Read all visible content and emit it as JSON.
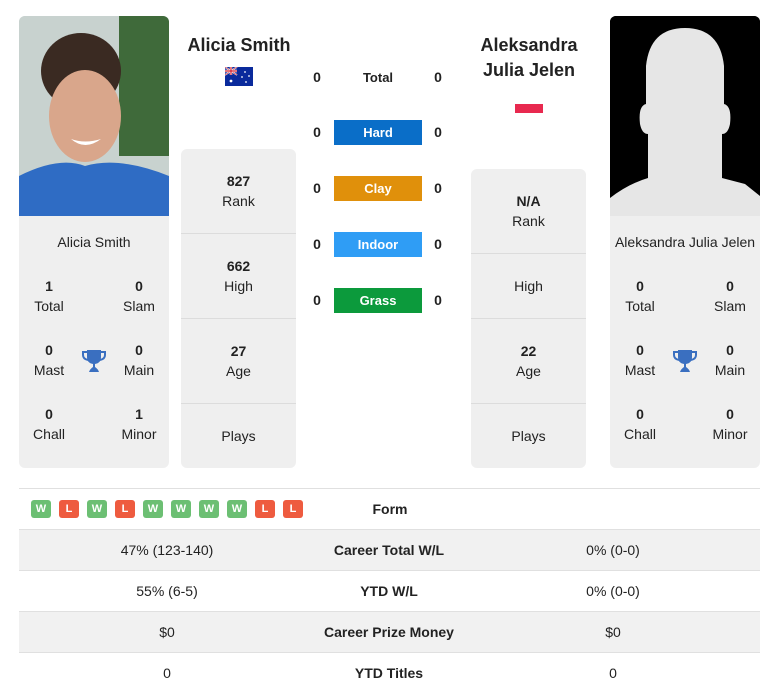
{
  "player1": {
    "name": "Alicia Smith",
    "flag": "australia-flag",
    "card_name": "Alicia Smith",
    "titles": {
      "total": {
        "value": "1",
        "label": "Total"
      },
      "slam": {
        "value": "0",
        "label": "Slam"
      },
      "mast": {
        "value": "0",
        "label": "Mast"
      },
      "main": {
        "value": "0",
        "label": "Main"
      },
      "chall": {
        "value": "0",
        "label": "Chall"
      },
      "minor": {
        "value": "1",
        "label": "Minor"
      }
    },
    "rank": {
      "value": "827",
      "label": "Rank"
    },
    "high": {
      "value": "662",
      "label": "High"
    },
    "age": {
      "value": "27",
      "label": "Age"
    },
    "plays": {
      "value": "",
      "label": "Plays"
    }
  },
  "player2": {
    "name": "Aleksandra Julia Jelen",
    "flag": "poland-flag",
    "card_name": "Aleksandra Julia Jelen",
    "titles": {
      "total": {
        "value": "0",
        "label": "Total"
      },
      "slam": {
        "value": "0",
        "label": "Slam"
      },
      "mast": {
        "value": "0",
        "label": "Mast"
      },
      "main": {
        "value": "0",
        "label": "Main"
      },
      "chall": {
        "value": "0",
        "label": "Chall"
      },
      "minor": {
        "value": "0",
        "label": "Minor"
      }
    },
    "rank": {
      "value": "N/A",
      "label": "Rank"
    },
    "high": {
      "value": "",
      "label": "High"
    },
    "age": {
      "value": "22",
      "label": "Age"
    },
    "plays": {
      "value": "",
      "label": "Plays"
    }
  },
  "h2h": [
    {
      "label": "Total",
      "p1": "0",
      "p2": "0",
      "color": ""
    },
    {
      "label": "Hard",
      "p1": "0",
      "p2": "0",
      "color": "#0a6ec8"
    },
    {
      "label": "Clay",
      "p1": "0",
      "p2": "0",
      "color": "#e0900b"
    },
    {
      "label": "Indoor",
      "p1": "0",
      "p2": "0",
      "color": "#2f9df5"
    },
    {
      "label": "Grass",
      "p1": "0",
      "p2": "0",
      "color": "#0c9a3c"
    }
  ],
  "form": {
    "label": "Form",
    "results": [
      "W",
      "L",
      "W",
      "L",
      "W",
      "W",
      "W",
      "W",
      "L",
      "L"
    ]
  },
  "table": [
    {
      "p1": "47% (123-140)",
      "label": "Career Total W/L",
      "p2": "0% (0-0)"
    },
    {
      "p1": "55% (6-5)",
      "label": "YTD W/L",
      "p2": "0% (0-0)"
    },
    {
      "p1": "$0",
      "label": "Career Prize Money",
      "p2": "$0"
    },
    {
      "p1": "0",
      "label": "YTD Titles",
      "p2": "0"
    }
  ],
  "colors": {
    "win": "#6cbf73",
    "loss": "#ee5b3f",
    "trophy": "#3a6fc0"
  }
}
